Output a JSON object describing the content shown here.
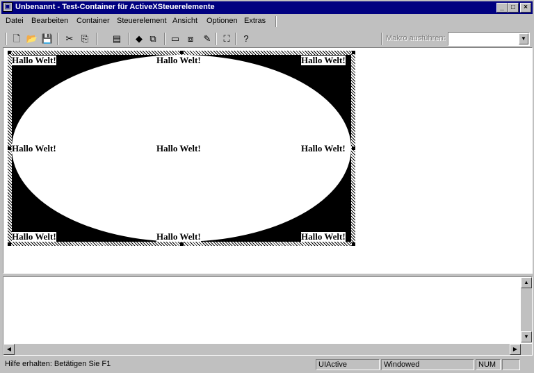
{
  "window": {
    "title": "Unbenannt - Test-Container für ActiveXSteuerelemente",
    "minimize": "_",
    "maximize": "□",
    "close": "×"
  },
  "menu": [
    "Datei",
    "Bearbeiten",
    "Container",
    "Steuerelement",
    "Ansicht",
    "Optionen",
    "Extras"
  ],
  "toolbar": {
    "macro_label": "Makro ausführen:",
    "macro_value": "",
    "icons": [
      "new-file-icon",
      "open-folder-icon",
      "save-icon",
      "cut-icon",
      "copy-icon",
      "properties-icon",
      "insert-control-icon",
      "insert-object-icon",
      "control-properties-icon",
      "methods-icon",
      "invoke-icon",
      "grid-icon",
      "help-icon"
    ]
  },
  "control": {
    "text": "Hallo Welt!",
    "labels": [
      "Hallo Welt!",
      "Hallo Welt!",
      "Hallo Welt!",
      "Hallo Welt!",
      "Hallo Welt!",
      "Hallo Welt!",
      "Hallo Welt!",
      "Hallo Welt!",
      "Hallo Welt!"
    ],
    "background": "#000000",
    "ellipse_fill": "#ffffff"
  },
  "status": {
    "help_text": "Hilfe erhalten: Betätigen Sie F1",
    "state": "UIActive",
    "mode": "Windowed",
    "num": "NUM"
  },
  "colors": {
    "titlebar": "#000080",
    "face": "#c0c0c0"
  }
}
